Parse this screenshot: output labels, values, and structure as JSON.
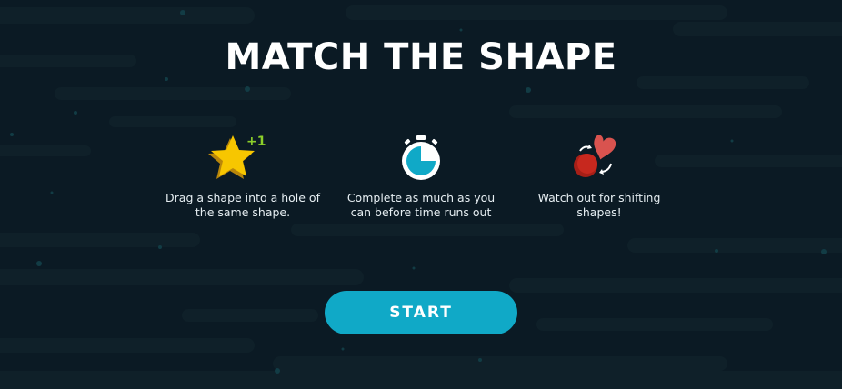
{
  "title": "MATCH THE SHAPE",
  "features": [
    {
      "icon": "star-plus-one-icon",
      "badge": "+1",
      "text": "Drag a shape into a hole of the same shape."
    },
    {
      "icon": "stopwatch-icon",
      "text": "Complete as much as you can before time runs out"
    },
    {
      "icon": "shifting-shapes-icon",
      "text": "Watch out for shifting shapes!"
    }
  ],
  "start_label": "START",
  "colors": {
    "background": "#0b1a24",
    "accent": "#10a9c7",
    "star": "#f7c600",
    "badge": "#8ccf2a",
    "heart": "#d9534f",
    "ball": "#c7281e"
  }
}
